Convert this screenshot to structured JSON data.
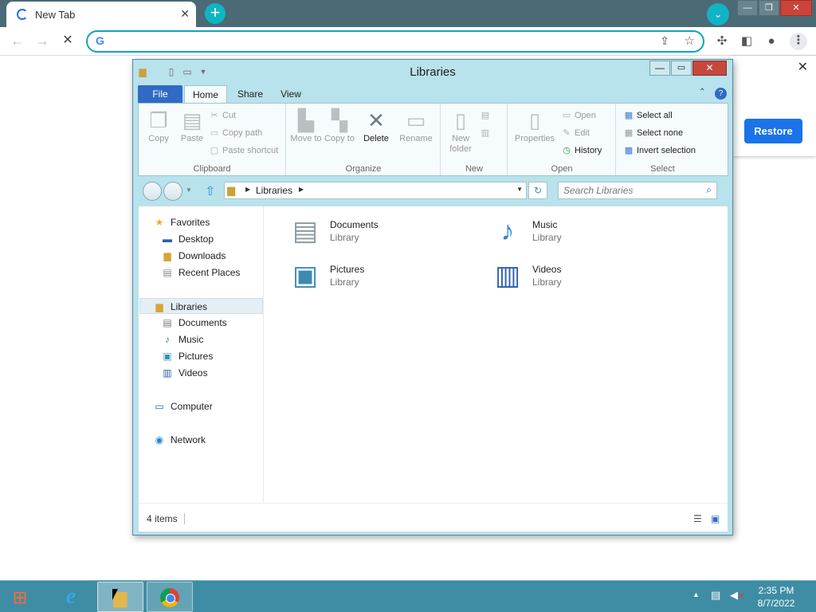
{
  "chrome": {
    "tab_title": "New Tab",
    "tab_close": "✕",
    "new_tab": "+",
    "tab_search": "⌄",
    "win_min": "—",
    "win_max": "❐",
    "win_close": "✕",
    "back": "←",
    "forward": "→",
    "stop": "✕",
    "omnibox_value": "",
    "omnibox_g": "G",
    "restore_label": "Restore",
    "restore_close": "✕",
    "accent": "#0fa5b8"
  },
  "explorer": {
    "title": "Libraries",
    "ribbon_tabs": [
      "File",
      "Home",
      "Share",
      "View"
    ],
    "groups": {
      "clipboard": "Clipboard",
      "organize": "Organize",
      "new": "New",
      "open": "Open",
      "select": "Select"
    },
    "buttons": {
      "copy": "Copy",
      "paste": "Paste",
      "cut": "Cut",
      "copy_path": "Copy path",
      "paste_shortcut": "Paste shortcut",
      "move_to": "Move to",
      "copy_to": "Copy to",
      "delete": "Delete",
      "rename": "Rename",
      "new_folder": "New folder",
      "properties": "Properties",
      "open": "Open",
      "edit": "Edit",
      "history": "History",
      "select_all": "Select all",
      "select_none": "Select none",
      "invert_selection": "Invert selection"
    },
    "breadcrumb": "Libraries",
    "search_placeholder": "Search Libraries",
    "nav": {
      "favorites": "Favorites",
      "desktop": "Desktop",
      "downloads": "Downloads",
      "recent_places": "Recent Places",
      "libraries": "Libraries",
      "documents": "Documents",
      "music": "Music",
      "pictures": "Pictures",
      "videos": "Videos",
      "computer": "Computer",
      "network": "Network"
    },
    "items": [
      {
        "name": "Documents",
        "type": "Library",
        "icon": "documents-library-icon"
      },
      {
        "name": "Music",
        "type": "Library",
        "icon": "music-library-icon"
      },
      {
        "name": "Pictures",
        "type": "Library",
        "icon": "pictures-library-icon"
      },
      {
        "name": "Videos",
        "type": "Library",
        "icon": "videos-library-icon"
      }
    ],
    "status": "4 items",
    "selection_accent": "#2f6bc4"
  },
  "taskbar": {
    "time": "2:35 PM",
    "date": "8/7/2022",
    "apps": [
      "internet-explorer-icon",
      "file-explorer-icon",
      "chrome-icon"
    ]
  }
}
